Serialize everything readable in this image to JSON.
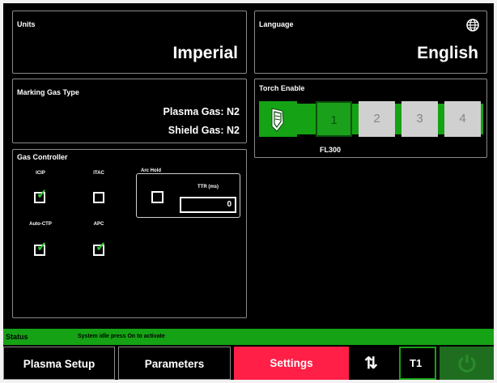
{
  "units": {
    "title": "Units",
    "value": "Imperial"
  },
  "language": {
    "title": "Language",
    "value": "English",
    "icon": "globe-icon"
  },
  "marking_gas": {
    "title": "Marking Gas Type",
    "plasma": "Plasma Gas: N2",
    "shield": "Shield Gas: N2"
  },
  "gas_controller": {
    "title": "Gas Controller",
    "checks": [
      {
        "label": "ICIP",
        "checked": true
      },
      {
        "label": "ITAC",
        "checked": false
      },
      {
        "label": "Auto-CTP",
        "checked": true
      },
      {
        "label": "APC",
        "checked": true
      }
    ],
    "arc_hold": {
      "title": "Arc Hold",
      "checked": false,
      "ttr_label": "TTR (ms)",
      "ttr_value": "0"
    }
  },
  "torch_enable": {
    "title": "Torch Enable",
    "torches": [
      {
        "label": "1",
        "enabled": true
      },
      {
        "label": "2",
        "enabled": false
      },
      {
        "label": "3",
        "enabled": false
      },
      {
        "label": "4",
        "enabled": false
      }
    ],
    "model": "FL300"
  },
  "status": {
    "label": "Status",
    "message": "System idle press On to activate"
  },
  "nav": {
    "plasma_setup": "Plasma Setup",
    "parameters": "Parameters",
    "settings": "Settings",
    "torch": "T1"
  },
  "colors": {
    "accent_green": "#15a215",
    "settings_red": "#ff1f47",
    "panel_border": "#8a8a8a"
  }
}
